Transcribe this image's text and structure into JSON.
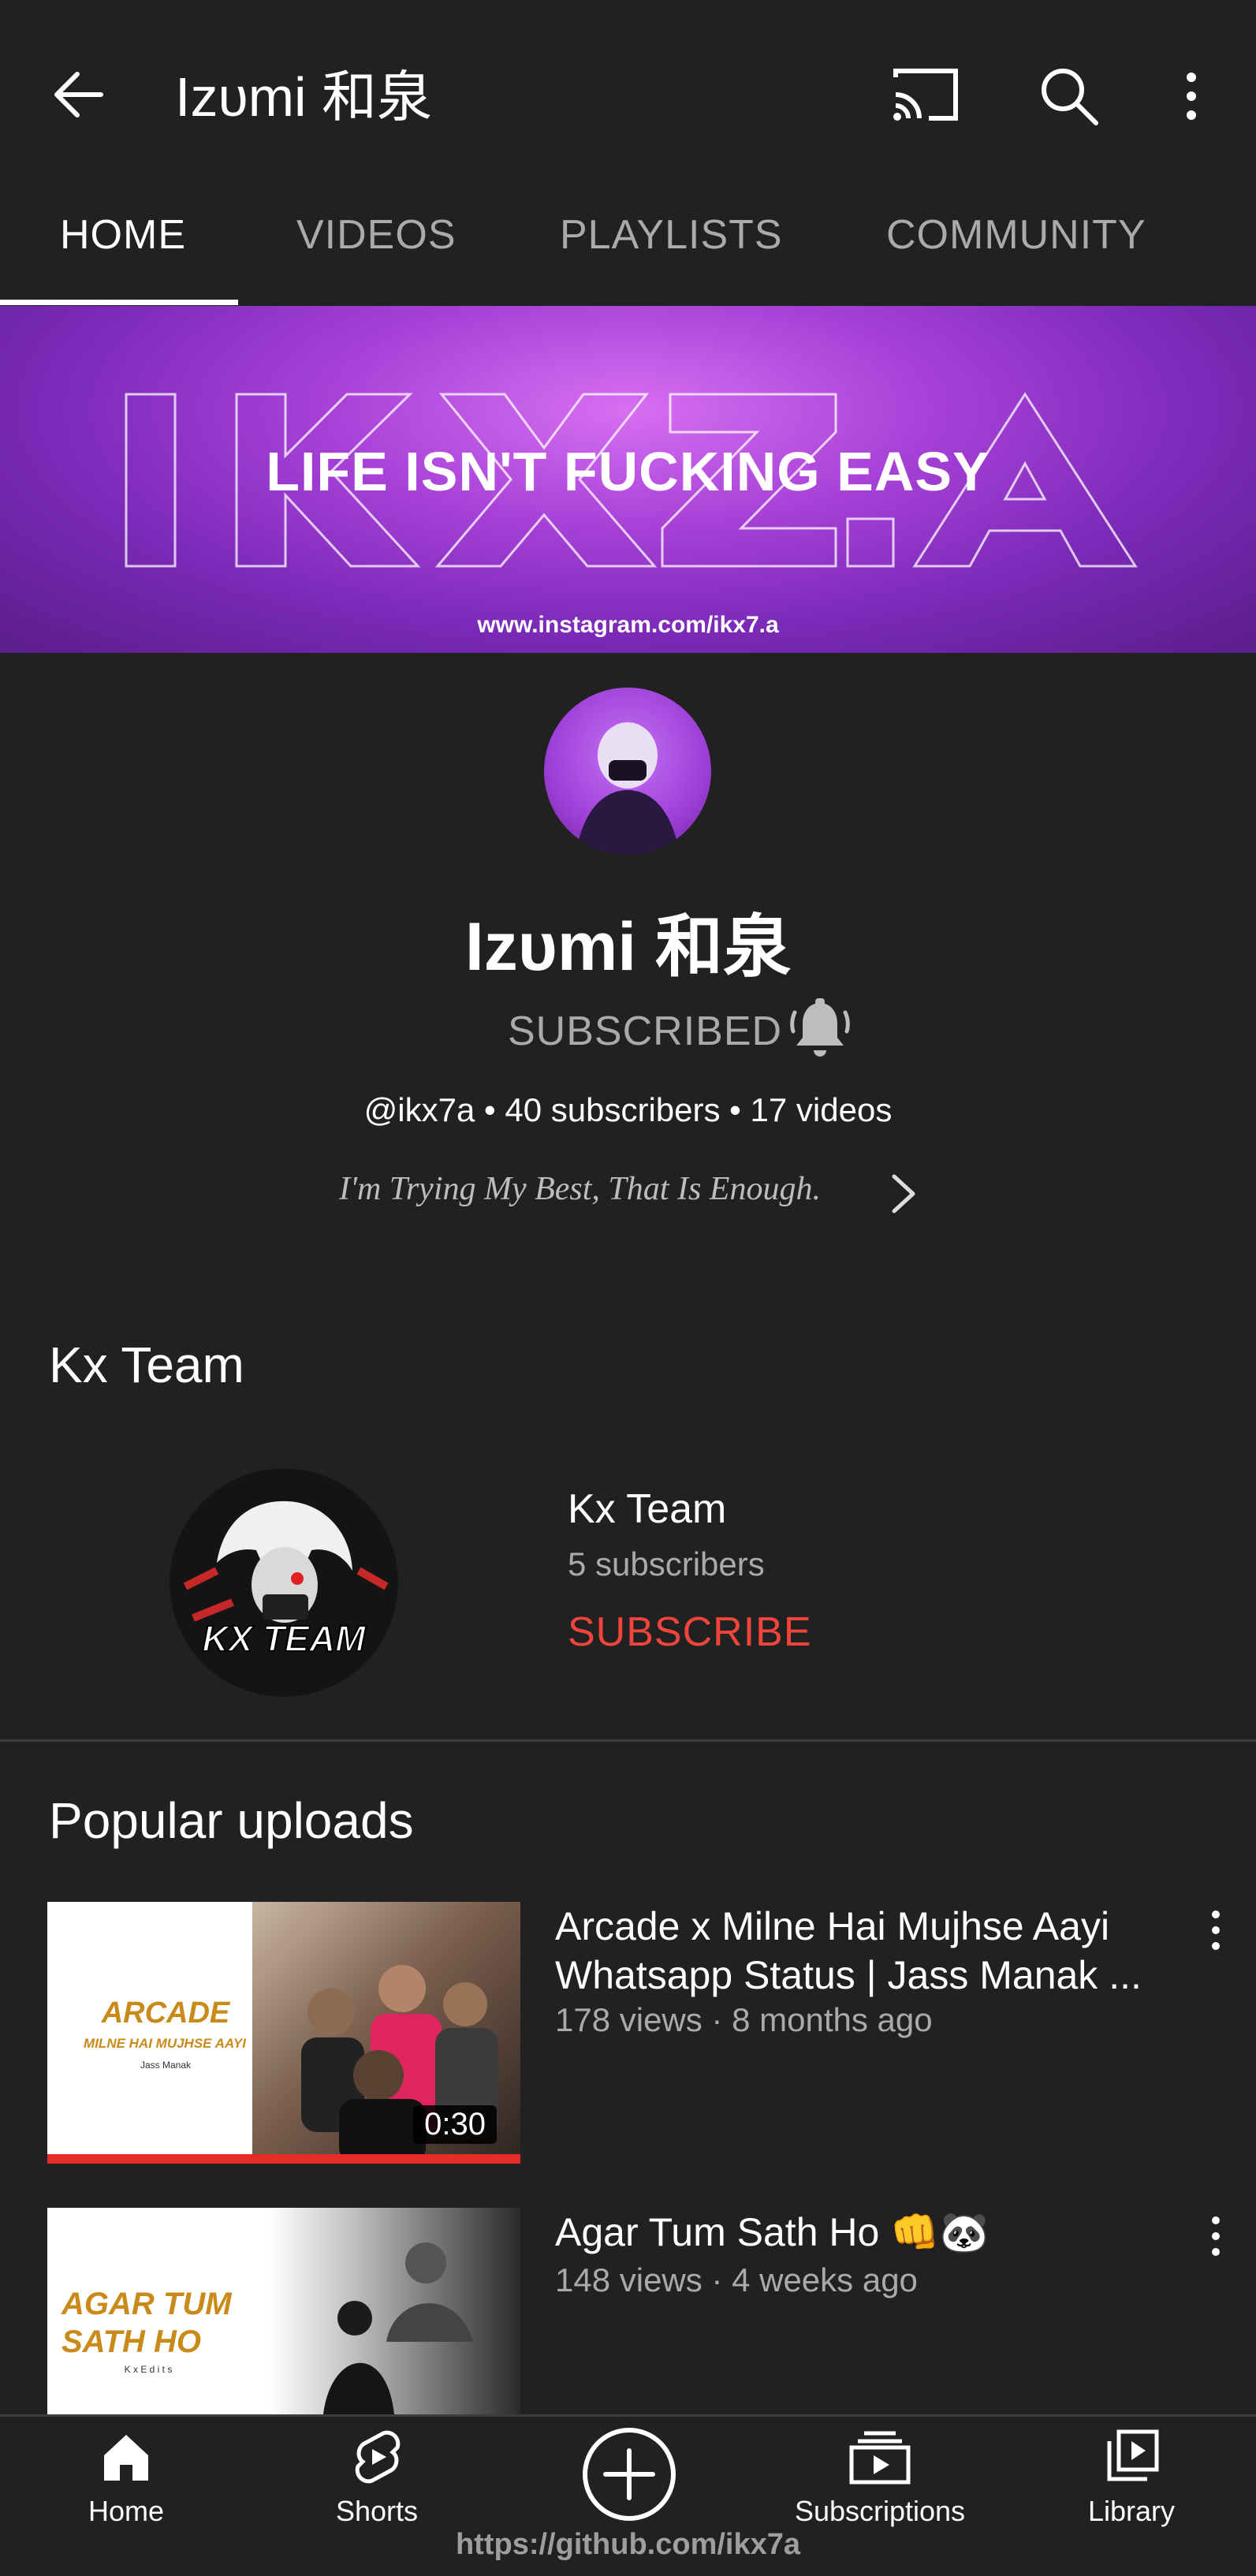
{
  "header": {
    "title": "Izυmi 和泉"
  },
  "tabs": [
    {
      "label": "HOME",
      "active": true
    },
    {
      "label": "VIDEOS",
      "active": false
    },
    {
      "label": "PLAYLISTS",
      "active": false
    },
    {
      "label": "COMMUNITY",
      "active": false
    }
  ],
  "banner": {
    "headline": "LIFE ISN'T FUCKING EASY",
    "url": "www.instagram.com/ikx7.a"
  },
  "channel": {
    "name": "Izυmi 和泉",
    "subscribe_state": "SUBSCRIBED",
    "handle": "@ikx7a",
    "subscribers": "40 subscribers",
    "videos": "17 videos",
    "tagline": "I'm Trying My Best, That Is Enough."
  },
  "featured": {
    "section_title": "Kx Team",
    "channel_name": "Kx Team",
    "subscribers": "5 subscribers",
    "subscribe_label": "SUBSCRIBE",
    "avatar_text": "KX TEAM"
  },
  "popular": {
    "section_title": "Popular uploads",
    "videos": [
      {
        "title": "Arcade x Milne Hai Mujhse Aayi Whatsapp Status | Jass Manak ...",
        "meta": "178 views · 8 months ago",
        "duration": "0:30",
        "thumb_title": "ARCADE",
        "thumb_subtitle": "MILNE HAI MUJHSE AAYI",
        "thumb_artist": "Jass Manak",
        "watched_fraction": 1.0
      },
      {
        "title": "Agar Tum Sath Ho 👊🐼",
        "meta": "148 views · 4 weeks ago",
        "thumb_title_line1": "AGAR TUM",
        "thumb_title_line2": "SATH HO",
        "thumb_caption": "K x  E d i t s"
      }
    ]
  },
  "bottom_nav": [
    {
      "label": "Home",
      "icon": "home-icon"
    },
    {
      "label": "Shorts",
      "icon": "shorts-icon"
    },
    {
      "label": "",
      "icon": "create-icon"
    },
    {
      "label": "Subscriptions",
      "icon": "subscriptions-icon"
    },
    {
      "label": "Library",
      "icon": "library-icon"
    }
  ],
  "watermark": "https://github.com/ikx7a",
  "colors": {
    "background": "#212121",
    "subscribe_red": "#f1443b",
    "secondary_text": "#aaaaaa",
    "banner_purple": "#a640d6"
  }
}
